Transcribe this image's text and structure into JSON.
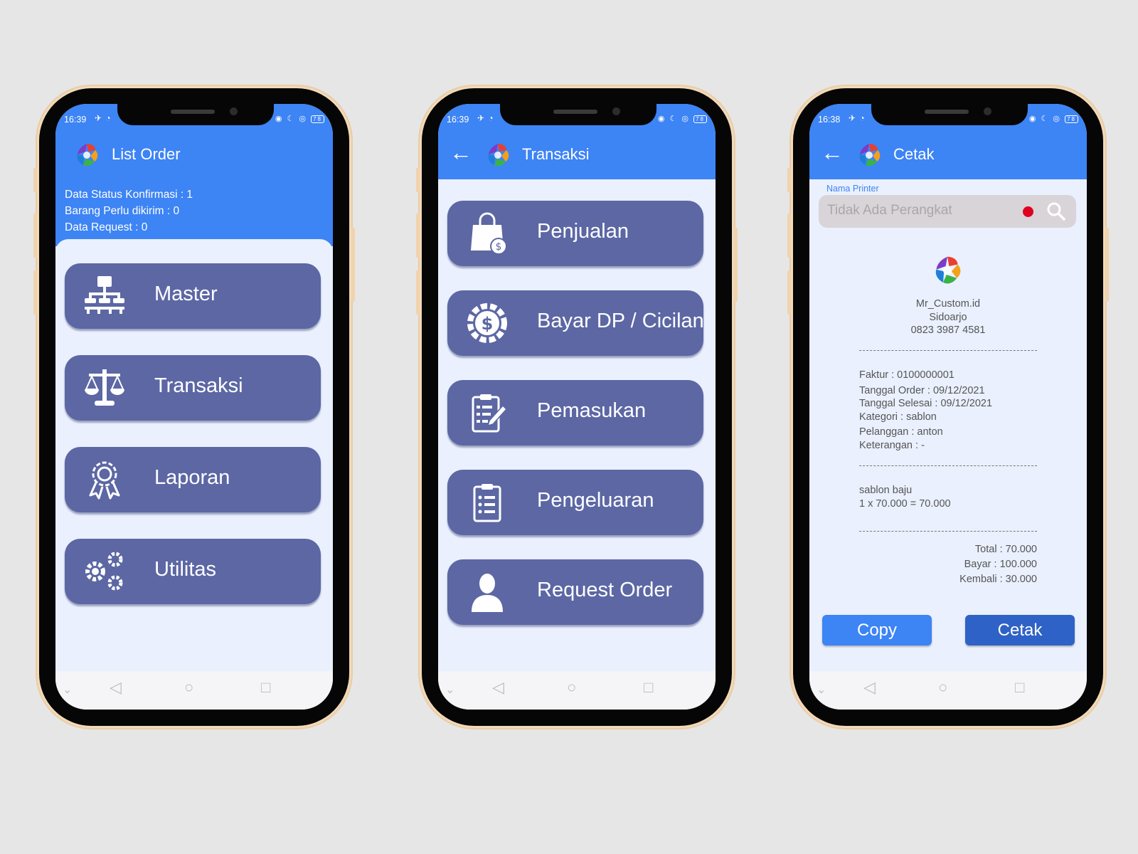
{
  "colors": {
    "primary": "#3d84f5",
    "menu_button": "#5c67a4",
    "background": "#e6e6e6",
    "screen": "#eaf0fd",
    "print_button": "#2f62c6",
    "status_dot": "#e00020"
  },
  "phone1": {
    "status_time": "16:39",
    "title": "List Order",
    "info": [
      "Data Status Konfirmasi : 1",
      "Barang Perlu dikirim : 0",
      "Data Request : 0"
    ],
    "menu": [
      {
        "label": "Master",
        "icon": "sitemap-icon"
      },
      {
        "label": "Transaksi",
        "icon": "scale-icon"
      },
      {
        "label": "Laporan",
        "icon": "award-icon"
      },
      {
        "label": "Utilitas",
        "icon": "gears-icon"
      }
    ]
  },
  "phone2": {
    "status_time": "16:39",
    "title": "Transaksi",
    "menu": [
      {
        "label": "Penjualan",
        "icon": "shopping-bag-icon"
      },
      {
        "label": "Bayar DP / Cicilan",
        "icon": "dollar-gear-icon"
      },
      {
        "label": "Pemasukan",
        "icon": "clipboard-edit-icon"
      },
      {
        "label": "Pengeluaran",
        "icon": "clipboard-list-icon"
      },
      {
        "label": "Request Order",
        "icon": "user-icon"
      }
    ]
  },
  "phone3": {
    "status_time": "16:38",
    "title": "Cetak",
    "printer_label": "Nama Printer",
    "printer_placeholder": "Tidak Ada Perangkat",
    "shop_name": "Mr_Custom.id",
    "shop_city": "Sidoarjo",
    "shop_phone": "0823 3987 4581",
    "details": [
      "Faktur : 0100000001",
      "Tanggal Order : 09/12/2021",
      "Tanggal Selesai : 09/12/2021",
      "Kategori : sablon",
      "Pelanggan : anton",
      "Keterangan : -"
    ],
    "item_name": "sablon baju",
    "item_calc": "1 x 70.000 = 70.000",
    "totals": [
      "Total : 70.000",
      "Bayar : 100.000",
      "Kembali : 30.000"
    ],
    "copy_label": "Copy",
    "print_label": "Cetak"
  }
}
